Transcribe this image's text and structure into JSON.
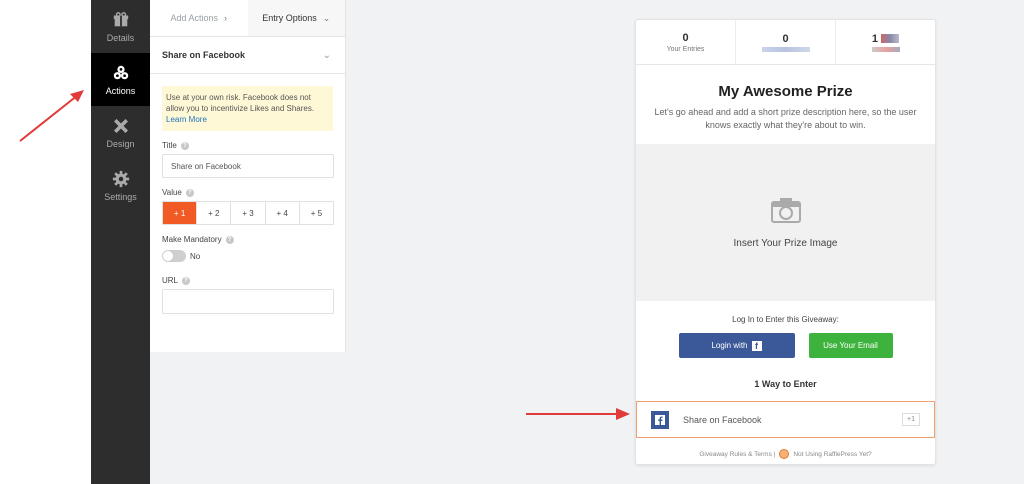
{
  "sidebar": {
    "items": [
      {
        "label": "Details"
      },
      {
        "label": "Actions"
      },
      {
        "label": "Design"
      },
      {
        "label": "Settings"
      }
    ]
  },
  "panel": {
    "tab_add": "Add Actions",
    "tab_entry": "Entry Options",
    "section_title": "Share on Facebook",
    "notice_text": "Use at your own risk. Facebook does not allow you to incentivize Likes and Shares.",
    "notice_link": "Learn More",
    "title_label": "Title",
    "title_value": "Share on Facebook",
    "value_label": "Value",
    "value_options": [
      "+ 1",
      "+ 2",
      "+ 3",
      "+ 4",
      "+ 5"
    ],
    "mandatory_label": "Make Mandatory",
    "mandatory_state": "No",
    "url_label": "URL",
    "url_value": ""
  },
  "preview": {
    "stats": [
      {
        "num": "0",
        "label": "Your Entries"
      },
      {
        "num": "0",
        "label": ""
      },
      {
        "num": "1",
        "label": ""
      }
    ],
    "prize_title": "My Awesome Prize",
    "prize_desc": "Let's go ahead and add a short prize description here, so the user knows exactly what they're about to win.",
    "image_caption": "Insert Your Prize Image",
    "login_hint": "Log In to Enter this Giveaway:",
    "btn_facebook": "Login with",
    "btn_email": "Use Your Email",
    "ways_title": "1 Way to Enter",
    "entry_label": "Share on Facebook",
    "entry_value": "+1",
    "footer_rules": "Giveaway Rules & Terms |",
    "footer_link": "Not Using RafflePress Yet?"
  },
  "colors": {
    "accent": "#f15a24",
    "facebook": "#3b5998",
    "email_green": "#3db33d",
    "arrow": "#e03a3a"
  }
}
